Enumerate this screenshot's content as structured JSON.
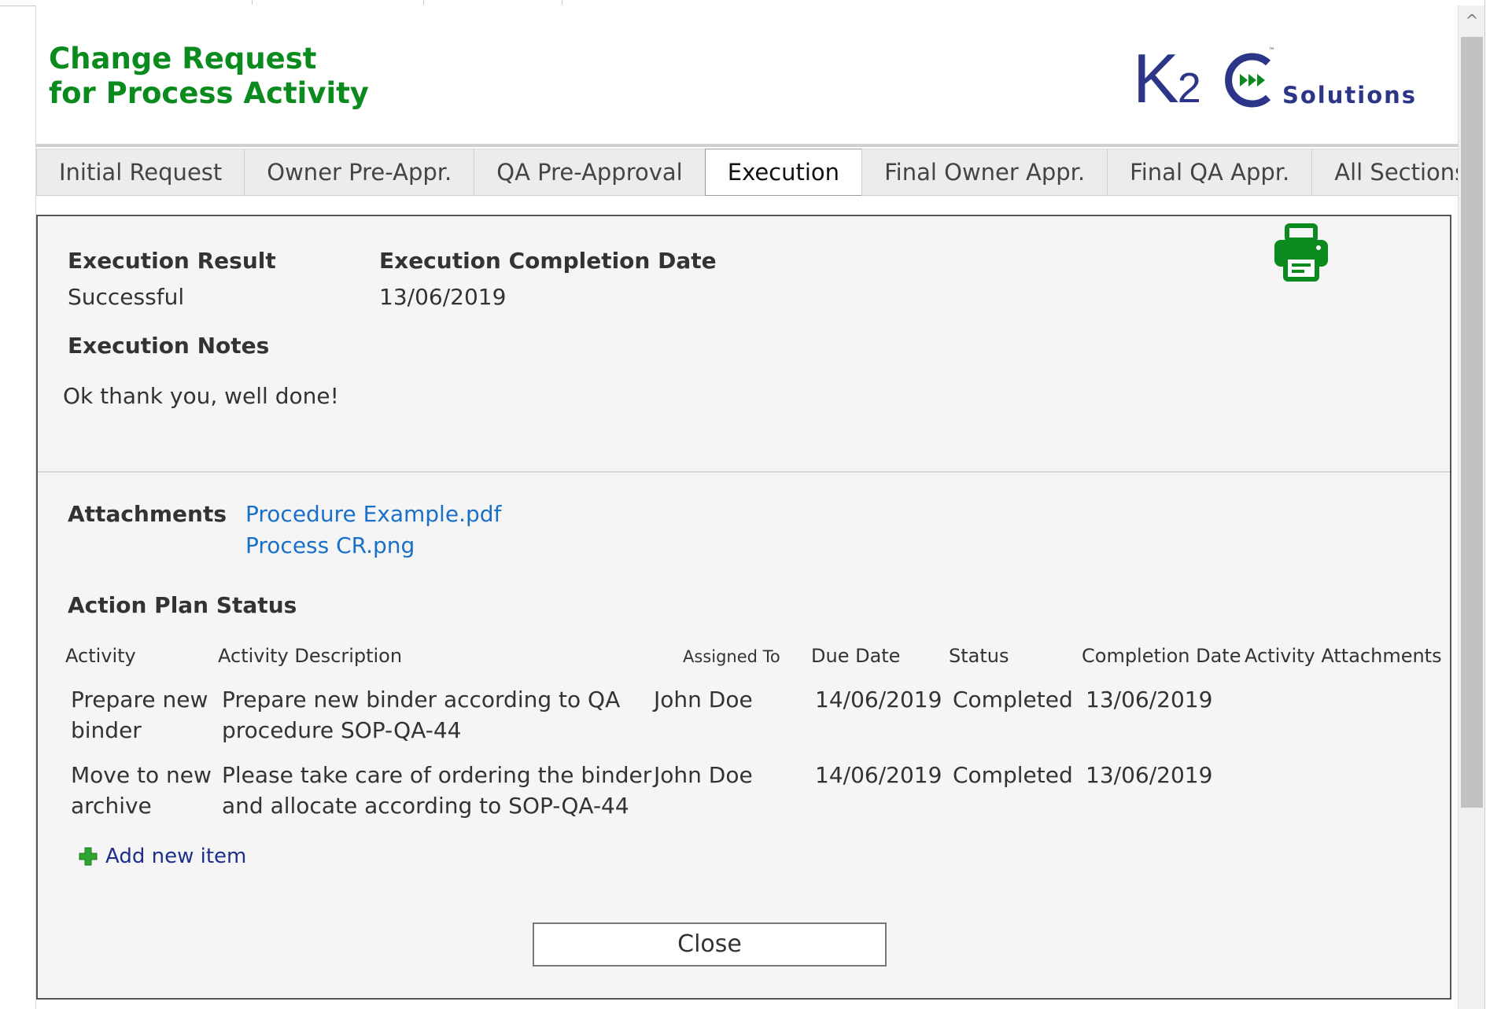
{
  "header": {
    "title_line1": "Change Request",
    "title_line2": "for Process Activity",
    "logo": {
      "k_text": "K",
      "two_text": "2",
      "tm_text": "™",
      "solutions_text": "Solutions",
      "brand_color": "#2c3587",
      "accent_color": "#0b8a1e"
    }
  },
  "tabs": [
    {
      "label": "Initial Request",
      "active": false
    },
    {
      "label": "Owner Pre-Appr.",
      "active": false
    },
    {
      "label": "QA Pre-Approval",
      "active": false
    },
    {
      "label": "Execution",
      "active": true
    },
    {
      "label": "Final Owner Appr.",
      "active": false
    },
    {
      "label": "Final QA Appr.",
      "active": false
    },
    {
      "label": "All Sections",
      "active": false
    }
  ],
  "execution": {
    "result_label": "Execution Result",
    "result_value": "Successful",
    "completion_date_label": "Execution Completion Date",
    "completion_date_value": "13/06/2019",
    "notes_label": "Execution Notes",
    "notes_value": "Ok thank you, well done!",
    "print_icon": "printer-icon"
  },
  "attachments": {
    "label": "Attachments",
    "files": [
      "Procedure Example.pdf",
      "Process CR.png"
    ]
  },
  "action_plan": {
    "title": "Action Plan Status",
    "columns": {
      "activity": "Activity",
      "description": "Activity Description",
      "assigned_to": "Assigned To",
      "due_date": "Due Date",
      "status": "Status",
      "completion_date": "Completion Date",
      "attachments": "Activity Attachments"
    },
    "rows": [
      {
        "activity": "Prepare new binder",
        "description": "Prepare new binder according to QA procedure SOP-QA-44",
        "assigned_to": "John Doe",
        "due_date": "14/06/2019",
        "status": "Completed",
        "completion_date": "13/06/2019",
        "attachments": ""
      },
      {
        "activity": "Move to new archive",
        "description": "Please take care of ordering the binder and allocate according to SOP-QA-44",
        "assigned_to": "John Doe",
        "due_date": "14/06/2019",
        "status": "Completed",
        "completion_date": "13/06/2019",
        "attachments": ""
      }
    ],
    "add_new_label": "Add new item",
    "add_icon": "plus-icon"
  },
  "close_label": "Close",
  "scrollbar": {
    "up_arrow": "^"
  }
}
